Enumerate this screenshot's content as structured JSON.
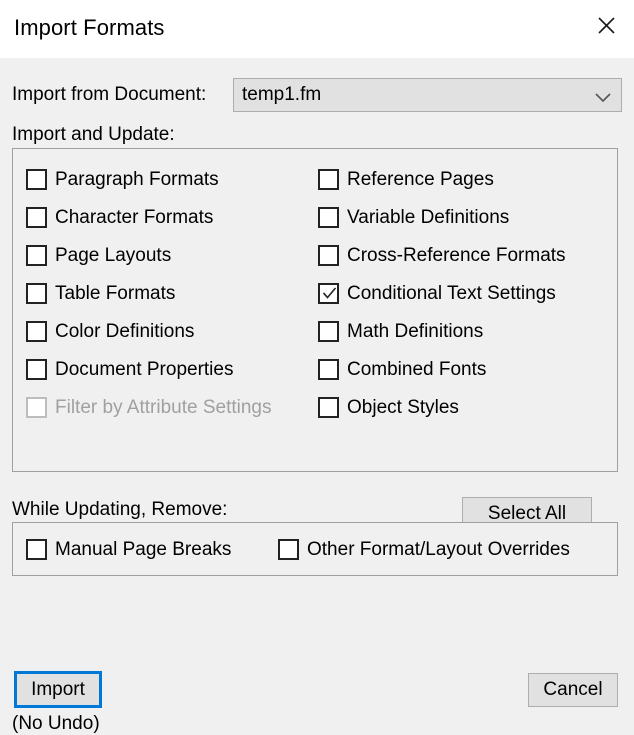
{
  "window": {
    "title": "Import Formats",
    "close_icon": "close-icon"
  },
  "import_from": {
    "label": "Import from Document:",
    "value": "temp1.fm",
    "arrow_icon": "chevron-down-icon"
  },
  "sections": {
    "import_and_update": "Import and Update:",
    "while_updating_remove": "While Updating, Remove:"
  },
  "import_and_update_options": {
    "left_column": [
      {
        "label": "Paragraph Formats",
        "checked": false,
        "disabled": false
      },
      {
        "label": "Character Formats",
        "checked": false,
        "disabled": false
      },
      {
        "label": "Page Layouts",
        "checked": false,
        "disabled": false
      },
      {
        "label": "Table Formats",
        "checked": false,
        "disabled": false
      },
      {
        "label": "Color Definitions",
        "checked": false,
        "disabled": false
      },
      {
        "label": "Document Properties",
        "checked": false,
        "disabled": false
      },
      {
        "label": "Filter by Attribute Settings",
        "checked": false,
        "disabled": true
      }
    ],
    "right_column": [
      {
        "label": "Reference Pages",
        "checked": false,
        "disabled": false
      },
      {
        "label": "Variable Definitions",
        "checked": false,
        "disabled": false
      },
      {
        "label": "Cross-Reference Formats",
        "checked": false,
        "disabled": false
      },
      {
        "label": "Conditional Text Settings",
        "checked": true,
        "disabled": false
      },
      {
        "label": "Math Definitions",
        "checked": false,
        "disabled": false
      },
      {
        "label": "Combined Fonts",
        "checked": false,
        "disabled": false
      },
      {
        "label": "Object Styles",
        "checked": false,
        "disabled": false
      }
    ]
  },
  "while_updating_remove_options": [
    {
      "label": "Manual Page Breaks",
      "checked": false,
      "disabled": false
    },
    {
      "label": "Other Format/Layout Overrides",
      "checked": false,
      "disabled": false
    }
  ],
  "buttons": {
    "select_all": "Select All",
    "import": "Import",
    "cancel": "Cancel"
  },
  "footer": {
    "no_undo": "(No Undo)"
  },
  "colors": {
    "focus_border": "#0078d7",
    "button_face": "#e1e1e1",
    "button_border": "#adadad",
    "dialog_background": "#f0f0f0",
    "titlebar_background": "#ffffff",
    "groupbox_border": "#a0a0a0",
    "disabled_text": "#a0a0a0"
  }
}
